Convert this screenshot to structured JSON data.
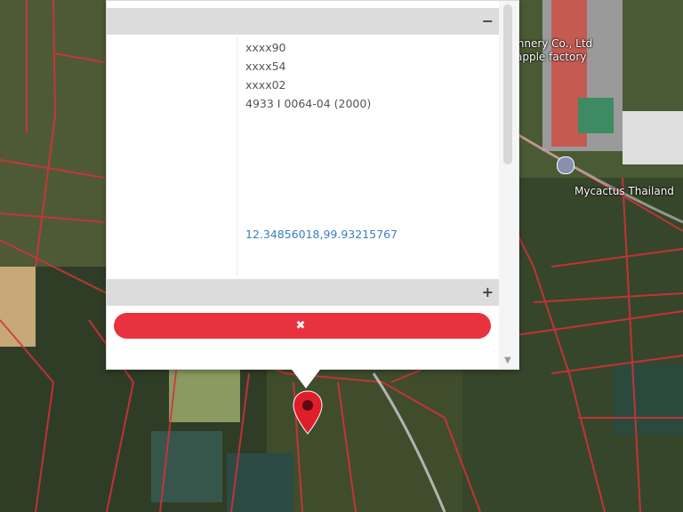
{
  "colors": {
    "accent": "#e8323f",
    "link": "#3a7fc1",
    "parcel_line": "#d9303b"
  },
  "map": {
    "label_top": "",
    "label_cannery": "Cannery Co., Ltd",
    "label_apple": "apple factory",
    "label_mycactus": "Mycactus Thailand",
    "label_pin": ""
  },
  "popup": {
    "section_land": {
      "title": "",
      "icon": "minus-icon"
    },
    "fields": [
      {
        "key": "",
        "value": "xxxx90"
      },
      {
        "key": "",
        "value": "xxxx54"
      },
      {
        "key": "",
        "value": "xxxx02"
      },
      {
        "key": "",
        "value": "4933 I 0064-04 (2000)"
      },
      {
        "key": "",
        "value": ""
      },
      {
        "key": "",
        "value": ""
      },
      {
        "key": "",
        "value": ""
      },
      {
        "key": "",
        "value": ""
      },
      {
        "key": "",
        "value": ""
      },
      {
        "key": "",
        "value": ""
      },
      {
        "key": "",
        "value": "12.34856018,99.93215767"
      },
      {
        "key": "",
        "value": ""
      },
      {
        "key": "",
        "value": ""
      }
    ],
    "section_office": {
      "title": "",
      "icon": "plus-icon"
    },
    "close_button": {
      "label": "",
      "icon": "close-icon"
    }
  }
}
